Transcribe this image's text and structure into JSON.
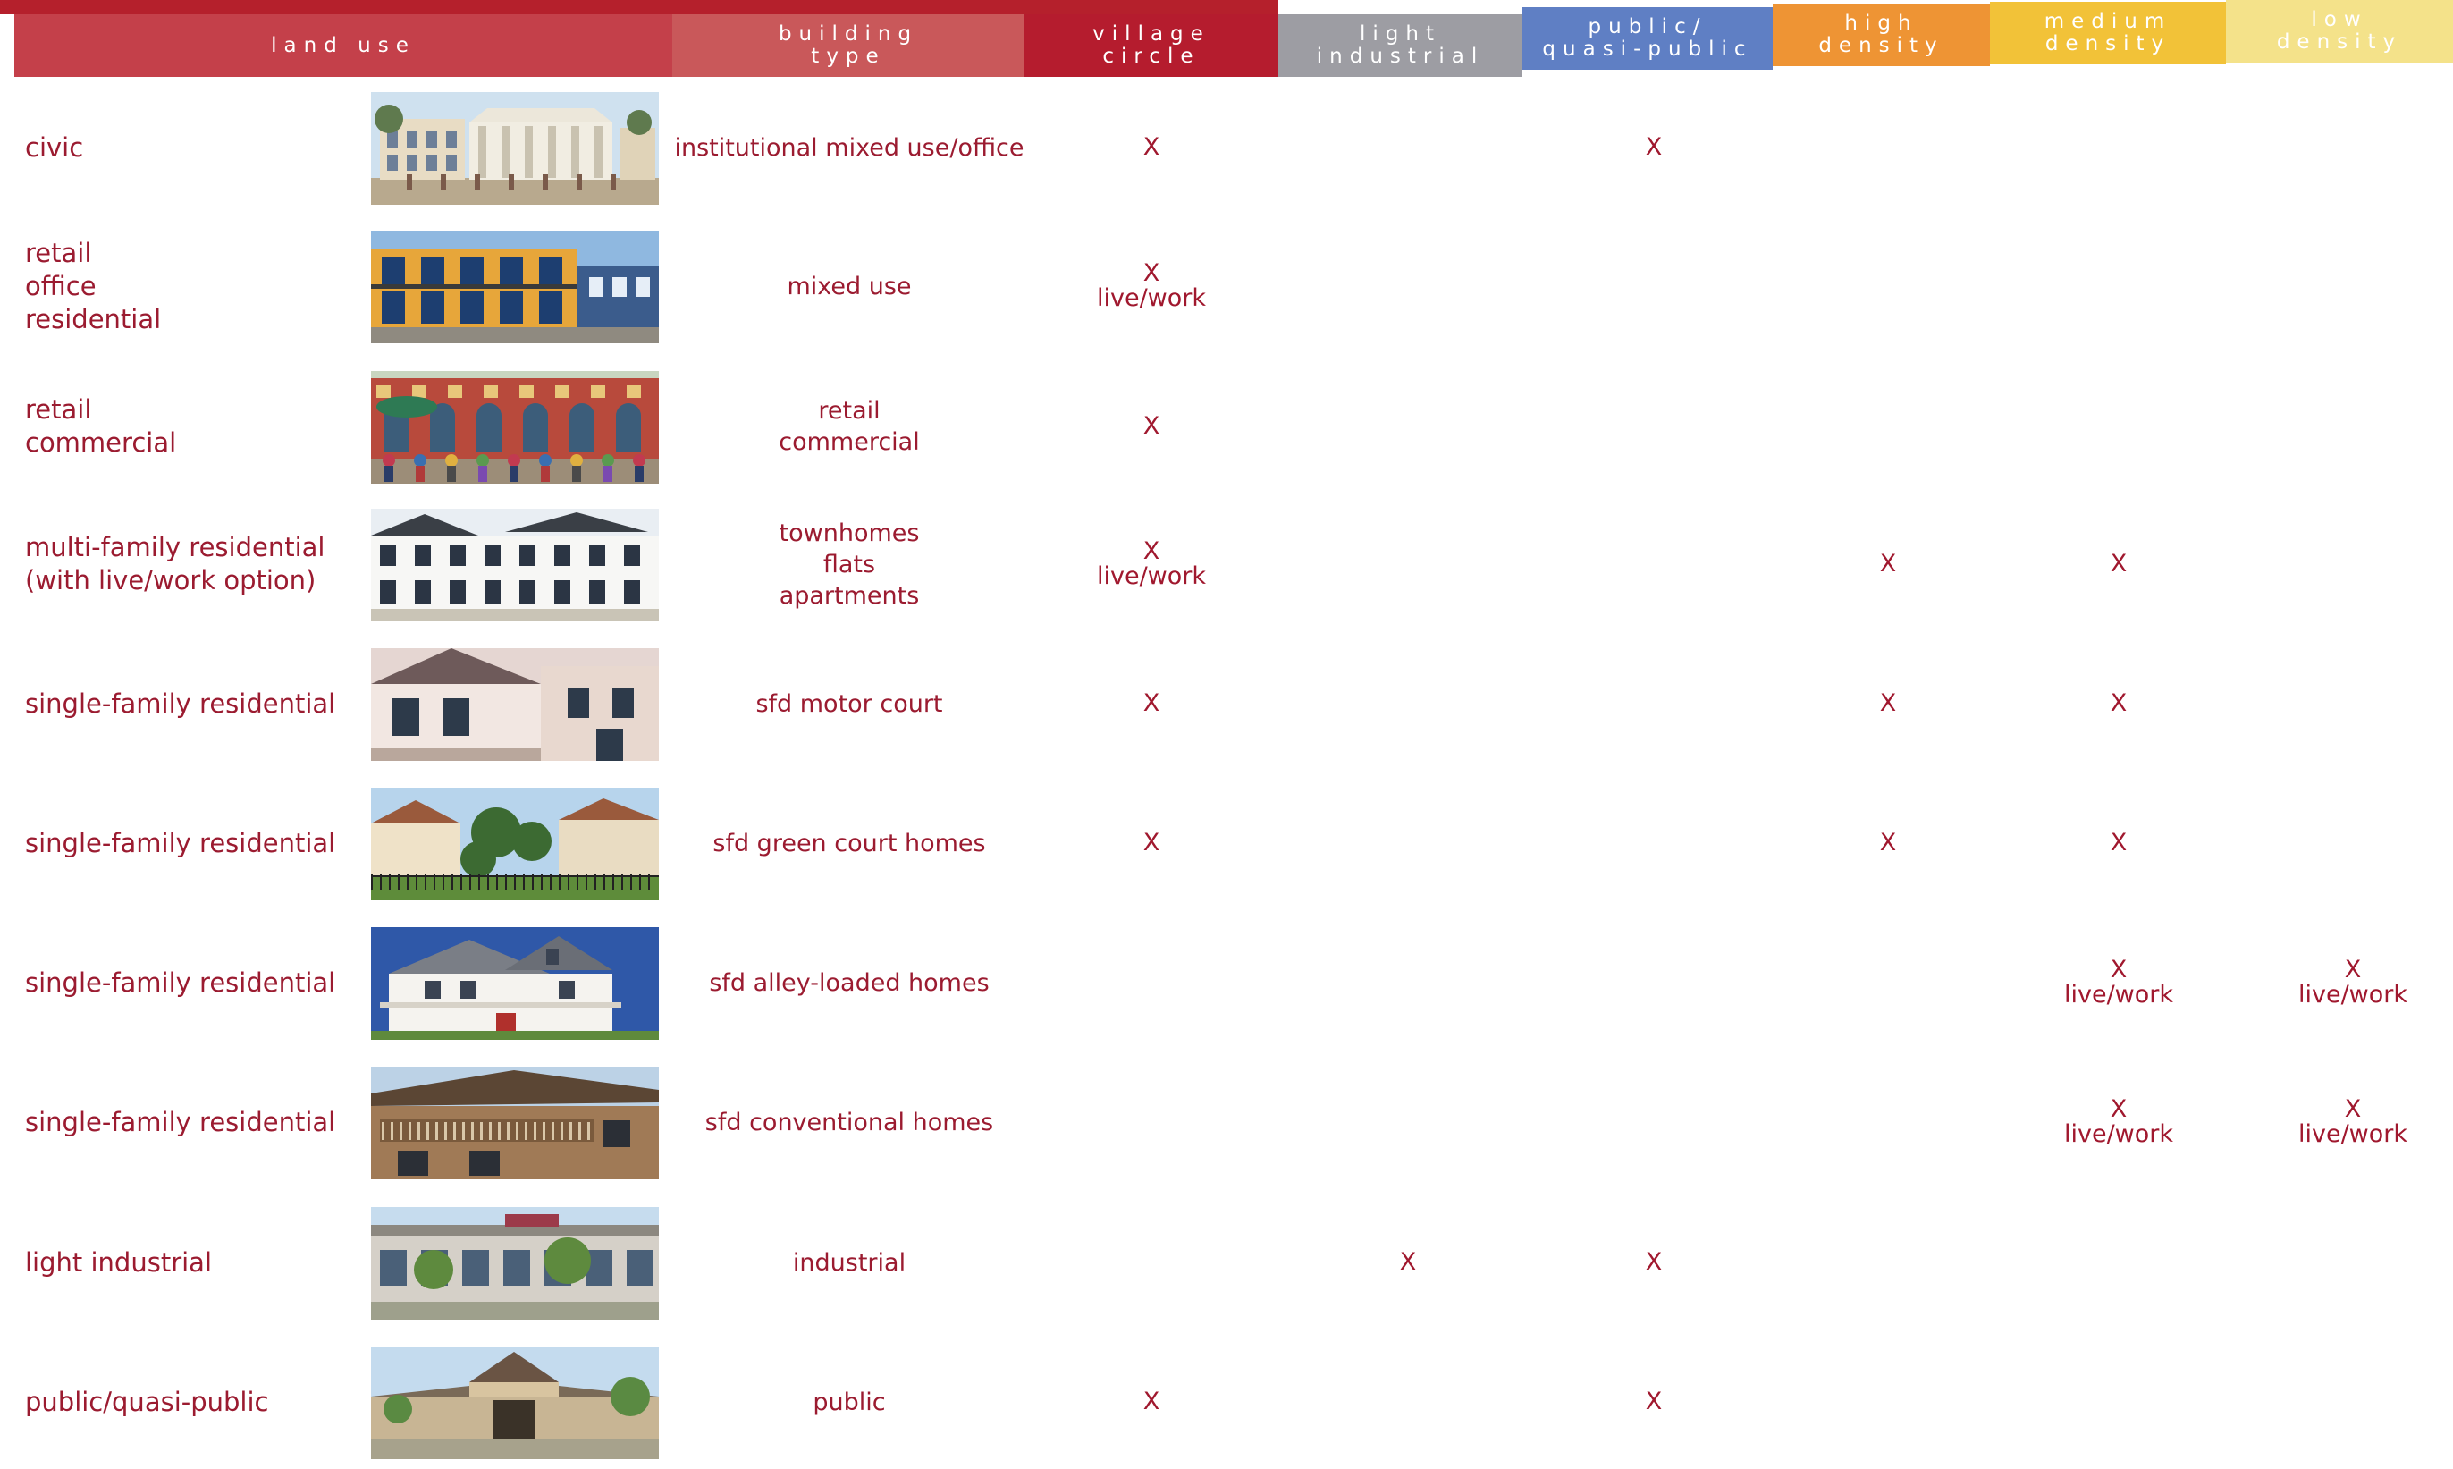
{
  "header": {
    "columns": [
      {
        "key": "land_use",
        "label": "land use",
        "color": "#c4404a"
      },
      {
        "key": "building_type",
        "label": "building\ntype",
        "color": "#c9585a"
      },
      {
        "key": "village_circle",
        "label": "village\ncircle",
        "color": "#b51c2e"
      },
      {
        "key": "light_industrial",
        "label": "light\nindustrial",
        "color": "#9d9da3"
      },
      {
        "key": "public_quasi_public",
        "label": "public/\nquasi-public",
        "color": "#5f7fc4"
      },
      {
        "key": "high_density",
        "label": "high\ndensity",
        "color": "#ee9434"
      },
      {
        "key": "medium_density",
        "label": "medium\ndensity",
        "color": "#f2c238"
      },
      {
        "key": "low_density",
        "label": "low\ndensity",
        "color": "#f4e28a"
      }
    ]
  },
  "rows": [
    {
      "land_use": "civic",
      "building_type": "institutional mixed use/office",
      "marks": {
        "village_circle": "X",
        "public_quasi_public": "X"
      },
      "photo": "civic-building"
    },
    {
      "land_use": "retail\noffice\nresidential",
      "building_type": "mixed use",
      "marks": {
        "village_circle": "X\nlive/work"
      },
      "photo": "mixed-use-building"
    },
    {
      "land_use": "retail\ncommercial",
      "building_type": "retail\ncommercial",
      "marks": {
        "village_circle": "X"
      },
      "photo": "retail-street"
    },
    {
      "land_use": "multi-family residential\n(with live/work option)",
      "building_type": "townhomes\nflats\napartments",
      "marks": {
        "village_circle": "X\nlive/work",
        "high_density": "X",
        "medium_density": "X"
      },
      "photo": "townhomes"
    },
    {
      "land_use": "single-family residential",
      "building_type": "sfd motor court",
      "marks": {
        "village_circle": "X",
        "high_density": "X",
        "medium_density": "X"
      },
      "photo": "motor-court-house"
    },
    {
      "land_use": "single-family residential",
      "building_type": "sfd green court homes",
      "marks": {
        "village_circle": "X",
        "high_density": "X",
        "medium_density": "X"
      },
      "photo": "green-court-homes"
    },
    {
      "land_use": "single-family residential",
      "building_type": "sfd alley-loaded homes",
      "marks": {
        "medium_density": "X\nlive/work",
        "low_density": "X\nlive/work"
      },
      "photo": "alley-loaded-home"
    },
    {
      "land_use": "single-family residential",
      "building_type": "sfd conventional homes",
      "marks": {
        "medium_density": "X\nlive/work",
        "low_density": "X\nlive/work"
      },
      "photo": "conventional-home"
    },
    {
      "land_use": "light industrial",
      "building_type": "industrial",
      "marks": {
        "light_industrial": "X",
        "public_quasi_public": "X"
      },
      "photo": "industrial-building"
    },
    {
      "land_use": "public/quasi-public",
      "building_type": "public",
      "marks": {
        "village_circle": "X",
        "public_quasi_public": "X"
      },
      "photo": "public-building"
    }
  ]
}
